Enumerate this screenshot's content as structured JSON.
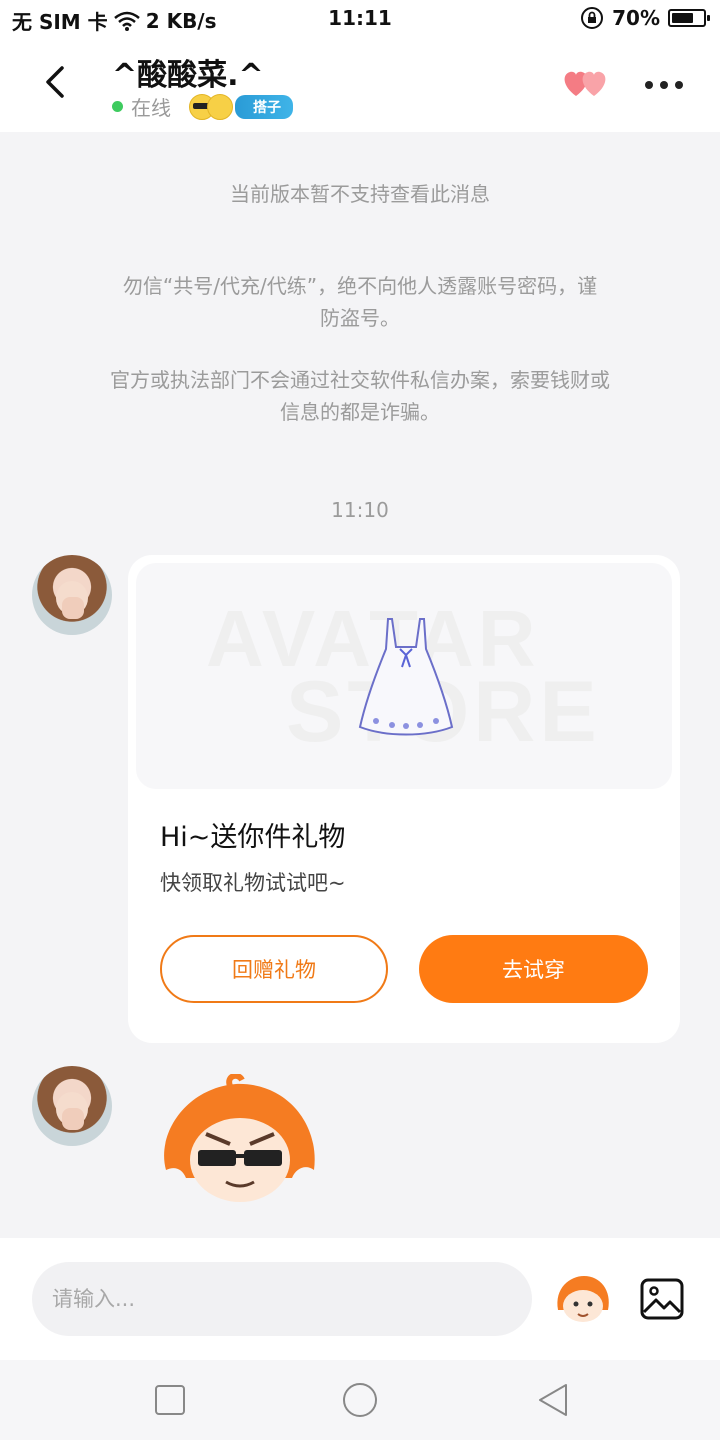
{
  "status_bar": {
    "carrier": "无 SIM 卡",
    "speed": "2 KB/s",
    "time": "11:11",
    "battery": "70%",
    "battery_level": 0.7
  },
  "header": {
    "title": "^酸酸菜.^",
    "online_text": "在线",
    "badge": "搭子"
  },
  "chat": {
    "unsupported_notice": "当前版本暂不支持查看此消息",
    "warning_1_line1": "勿信“共号/代充/代练”，绝不向他人透露账号密码，谨",
    "warning_1_line2": "防盗号。",
    "warning_2_line1": "官方或执法部门不会通过社交软件私信办案，索要钱财或",
    "warning_2_line2": "信息的都是诈骗。",
    "timestamp": "11:10",
    "gift_card": {
      "watermark_top": "AVATAR",
      "watermark_bottom": "STORE",
      "title": "Hi~送你件礼物",
      "subtitle": "快领取礼物试试吧~",
      "return_gift_label": "回赠礼物",
      "try_on_label": "去试穿"
    }
  },
  "input": {
    "placeholder": "请输入..."
  },
  "colors": {
    "accent": "#ff7b12",
    "online": "#3ecb5f",
    "badge": "#2a9bd6"
  }
}
